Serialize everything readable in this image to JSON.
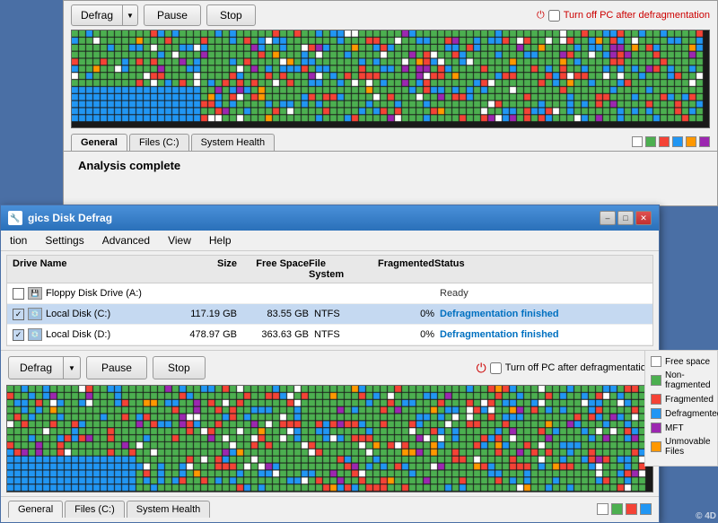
{
  "bgWindow": {
    "toolbar": {
      "defragLabel": "Defrag",
      "pauseLabel": "Pause",
      "stopLabel": "Stop",
      "powerLabel": "Turn off PC after defragmentation"
    },
    "tabs": [
      "General",
      "Files (C:)",
      "System Health"
    ],
    "analysisText": "Analysis complete",
    "legend": [
      "white",
      "#ccc",
      "#4caf50",
      "#f44336",
      "#2196f3",
      "#ff9800",
      "#9c27b0"
    ]
  },
  "mainWindow": {
    "titleBar": {
      "text": "gics Disk Defrag",
      "minimizeLabel": "–",
      "maximizeLabel": "□",
      "closeLabel": "✕"
    },
    "menuBar": [
      "tion",
      "Settings",
      "Advanced",
      "View",
      "Help"
    ],
    "driveList": {
      "headers": [
        "Drive Name",
        "Size",
        "Free Space",
        "File System",
        "Fragmented",
        "Status"
      ],
      "rows": [
        {
          "checkbox": false,
          "name": "Floppy Disk Drive (A:)",
          "size": "",
          "freeSpace": "",
          "fileSystem": "",
          "fragmented": "",
          "status": "Ready",
          "statusClass": "ready"
        },
        {
          "checkbox": true,
          "name": "Local Disk (C:)",
          "size": "117.19 GB",
          "freeSpace": "83.55 GB",
          "fileSystem": "NTFS",
          "fragmented": "0%",
          "status": "Defragmentation finished",
          "statusClass": "finished"
        },
        {
          "checkbox": true,
          "name": "Local Disk (D:)",
          "size": "478.97 GB",
          "freeSpace": "363.63 GB",
          "fileSystem": "NTFS",
          "fragmented": "0%",
          "status": "Defragmentation finished",
          "statusClass": "finished"
        }
      ]
    },
    "toolbar": {
      "defragLabel": "Defrag",
      "pauseLabel": "Pause",
      "stopLabel": "Stop",
      "powerLabel": "Turn off PC after defragmentation"
    },
    "tabs": [
      "General",
      "Files (C:)",
      "System Health"
    ],
    "legend": {
      "items": [
        {
          "label": "Free space",
          "color": "#ffffff"
        },
        {
          "label": "Non-fragmented",
          "color": "#4caf50"
        },
        {
          "label": "Fragmented",
          "color": "#f44336"
        },
        {
          "label": "Defragmented",
          "color": "#2196f3"
        },
        {
          "label": "MFT",
          "color": "#9c27b0"
        },
        {
          "label": "Unmovable Files",
          "color": "#ff9800"
        }
      ]
    }
  },
  "watermark": "© 4D"
}
